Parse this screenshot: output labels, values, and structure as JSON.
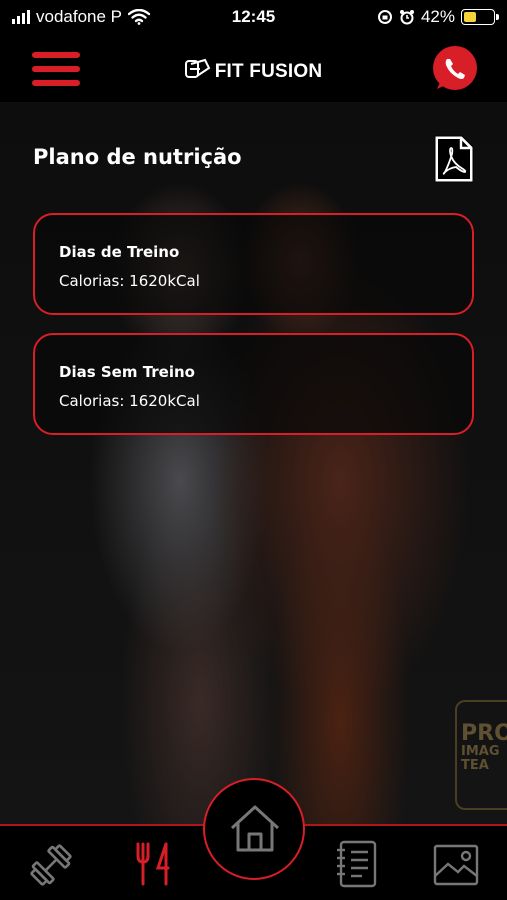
{
  "status_bar": {
    "carrier": "vodafone P",
    "time": "12:45",
    "battery_percent": "42%",
    "battery_level": 0.42,
    "battery_color": "#f3d23a"
  },
  "header": {
    "app_name": "FIT FUSION",
    "menu_icon": "hamburger-icon",
    "contact_icon": "whatsapp-icon",
    "accent_color": "#d81e26"
  },
  "main": {
    "title": "Plano de nutrição",
    "pdf_icon": "pdf-icon",
    "plans": [
      {
        "title": "Dias de Treino",
        "calories": "Calorias: 1620kCal"
      },
      {
        "title": "Dias Sem Treino",
        "calories": "Calorias: 1620kCal"
      }
    ]
  },
  "background": {
    "watermark_line1": "PRO",
    "watermark_line2": "IMAG",
    "watermark_line3": "TEA"
  },
  "bottom_nav": {
    "items": [
      {
        "icon": "dumbbell-icon",
        "active": false
      },
      {
        "icon": "fork-knife-icon",
        "active": true
      },
      {
        "icon": "home-icon",
        "active": false
      },
      {
        "icon": "notebook-icon",
        "active": false
      },
      {
        "icon": "gallery-icon",
        "active": false
      }
    ]
  }
}
